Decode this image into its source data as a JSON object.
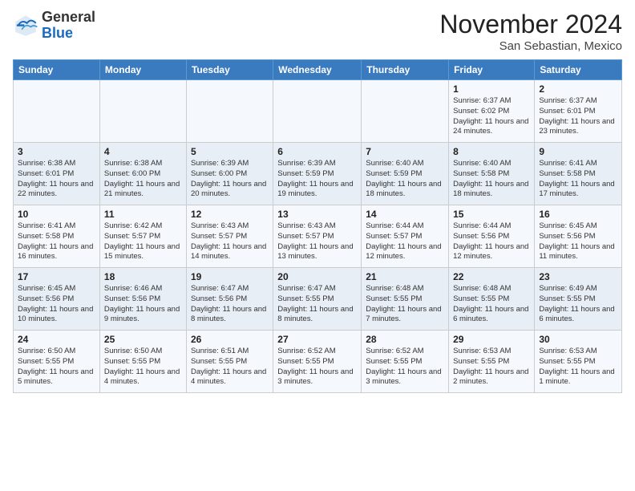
{
  "header": {
    "logo_general": "General",
    "logo_blue": "Blue",
    "month_title": "November 2024",
    "location": "San Sebastian, Mexico"
  },
  "weekdays": [
    "Sunday",
    "Monday",
    "Tuesday",
    "Wednesday",
    "Thursday",
    "Friday",
    "Saturday"
  ],
  "weeks": [
    [
      {
        "day": "",
        "sunrise": "",
        "sunset": "",
        "daylight": ""
      },
      {
        "day": "",
        "sunrise": "",
        "sunset": "",
        "daylight": ""
      },
      {
        "day": "",
        "sunrise": "",
        "sunset": "",
        "daylight": ""
      },
      {
        "day": "",
        "sunrise": "",
        "sunset": "",
        "daylight": ""
      },
      {
        "day": "",
        "sunrise": "",
        "sunset": "",
        "daylight": ""
      },
      {
        "day": "1",
        "sunrise": "Sunrise: 6:37 AM",
        "sunset": "Sunset: 6:02 PM",
        "daylight": "Daylight: 11 hours and 24 minutes."
      },
      {
        "day": "2",
        "sunrise": "Sunrise: 6:37 AM",
        "sunset": "Sunset: 6:01 PM",
        "daylight": "Daylight: 11 hours and 23 minutes."
      }
    ],
    [
      {
        "day": "3",
        "sunrise": "Sunrise: 6:38 AM",
        "sunset": "Sunset: 6:01 PM",
        "daylight": "Daylight: 11 hours and 22 minutes."
      },
      {
        "day": "4",
        "sunrise": "Sunrise: 6:38 AM",
        "sunset": "Sunset: 6:00 PM",
        "daylight": "Daylight: 11 hours and 21 minutes."
      },
      {
        "day": "5",
        "sunrise": "Sunrise: 6:39 AM",
        "sunset": "Sunset: 6:00 PM",
        "daylight": "Daylight: 11 hours and 20 minutes."
      },
      {
        "day": "6",
        "sunrise": "Sunrise: 6:39 AM",
        "sunset": "Sunset: 5:59 PM",
        "daylight": "Daylight: 11 hours and 19 minutes."
      },
      {
        "day": "7",
        "sunrise": "Sunrise: 6:40 AM",
        "sunset": "Sunset: 5:59 PM",
        "daylight": "Daylight: 11 hours and 18 minutes."
      },
      {
        "day": "8",
        "sunrise": "Sunrise: 6:40 AM",
        "sunset": "Sunset: 5:58 PM",
        "daylight": "Daylight: 11 hours and 18 minutes."
      },
      {
        "day": "9",
        "sunrise": "Sunrise: 6:41 AM",
        "sunset": "Sunset: 5:58 PM",
        "daylight": "Daylight: 11 hours and 17 minutes."
      }
    ],
    [
      {
        "day": "10",
        "sunrise": "Sunrise: 6:41 AM",
        "sunset": "Sunset: 5:58 PM",
        "daylight": "Daylight: 11 hours and 16 minutes."
      },
      {
        "day": "11",
        "sunrise": "Sunrise: 6:42 AM",
        "sunset": "Sunset: 5:57 PM",
        "daylight": "Daylight: 11 hours and 15 minutes."
      },
      {
        "day": "12",
        "sunrise": "Sunrise: 6:43 AM",
        "sunset": "Sunset: 5:57 PM",
        "daylight": "Daylight: 11 hours and 14 minutes."
      },
      {
        "day": "13",
        "sunrise": "Sunrise: 6:43 AM",
        "sunset": "Sunset: 5:57 PM",
        "daylight": "Daylight: 11 hours and 13 minutes."
      },
      {
        "day": "14",
        "sunrise": "Sunrise: 6:44 AM",
        "sunset": "Sunset: 5:57 PM",
        "daylight": "Daylight: 11 hours and 12 minutes."
      },
      {
        "day": "15",
        "sunrise": "Sunrise: 6:44 AM",
        "sunset": "Sunset: 5:56 PM",
        "daylight": "Daylight: 11 hours and 12 minutes."
      },
      {
        "day": "16",
        "sunrise": "Sunrise: 6:45 AM",
        "sunset": "Sunset: 5:56 PM",
        "daylight": "Daylight: 11 hours and 11 minutes."
      }
    ],
    [
      {
        "day": "17",
        "sunrise": "Sunrise: 6:45 AM",
        "sunset": "Sunset: 5:56 PM",
        "daylight": "Daylight: 11 hours and 10 minutes."
      },
      {
        "day": "18",
        "sunrise": "Sunrise: 6:46 AM",
        "sunset": "Sunset: 5:56 PM",
        "daylight": "Daylight: 11 hours and 9 minutes."
      },
      {
        "day": "19",
        "sunrise": "Sunrise: 6:47 AM",
        "sunset": "Sunset: 5:56 PM",
        "daylight": "Daylight: 11 hours and 8 minutes."
      },
      {
        "day": "20",
        "sunrise": "Sunrise: 6:47 AM",
        "sunset": "Sunset: 5:55 PM",
        "daylight": "Daylight: 11 hours and 8 minutes."
      },
      {
        "day": "21",
        "sunrise": "Sunrise: 6:48 AM",
        "sunset": "Sunset: 5:55 PM",
        "daylight": "Daylight: 11 hours and 7 minutes."
      },
      {
        "day": "22",
        "sunrise": "Sunrise: 6:48 AM",
        "sunset": "Sunset: 5:55 PM",
        "daylight": "Daylight: 11 hours and 6 minutes."
      },
      {
        "day": "23",
        "sunrise": "Sunrise: 6:49 AM",
        "sunset": "Sunset: 5:55 PM",
        "daylight": "Daylight: 11 hours and 6 minutes."
      }
    ],
    [
      {
        "day": "24",
        "sunrise": "Sunrise: 6:50 AM",
        "sunset": "Sunset: 5:55 PM",
        "daylight": "Daylight: 11 hours and 5 minutes."
      },
      {
        "day": "25",
        "sunrise": "Sunrise: 6:50 AM",
        "sunset": "Sunset: 5:55 PM",
        "daylight": "Daylight: 11 hours and 4 minutes."
      },
      {
        "day": "26",
        "sunrise": "Sunrise: 6:51 AM",
        "sunset": "Sunset: 5:55 PM",
        "daylight": "Daylight: 11 hours and 4 minutes."
      },
      {
        "day": "27",
        "sunrise": "Sunrise: 6:52 AM",
        "sunset": "Sunset: 5:55 PM",
        "daylight": "Daylight: 11 hours and 3 minutes."
      },
      {
        "day": "28",
        "sunrise": "Sunrise: 6:52 AM",
        "sunset": "Sunset: 5:55 PM",
        "daylight": "Daylight: 11 hours and 3 minutes."
      },
      {
        "day": "29",
        "sunrise": "Sunrise: 6:53 AM",
        "sunset": "Sunset: 5:55 PM",
        "daylight": "Daylight: 11 hours and 2 minutes."
      },
      {
        "day": "30",
        "sunrise": "Sunrise: 6:53 AM",
        "sunset": "Sunset: 5:55 PM",
        "daylight": "Daylight: 11 hours and 1 minute."
      }
    ]
  ]
}
